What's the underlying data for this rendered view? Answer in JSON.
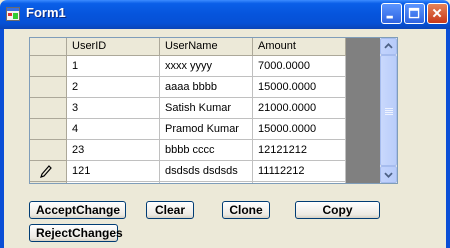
{
  "window": {
    "title": "Form1"
  },
  "grid": {
    "columns": [
      "UserID",
      "UserName",
      "Amount"
    ],
    "rows": [
      [
        "1",
        "xxxx yyyy",
        "7000.0000"
      ],
      [
        "2",
        "aaaa bbbb",
        "15000.0000"
      ],
      [
        "3",
        "Satish Kumar",
        "21000.0000"
      ],
      [
        "4",
        "Pramod Kumar",
        "15000.0000"
      ],
      [
        "23",
        "bbbb cccc",
        "12121212"
      ],
      [
        "121",
        "dsdsds dsdsds",
        "11112212"
      ]
    ],
    "editing_row": 5
  },
  "buttons": {
    "accept_changes": "AcceptChange",
    "clear": "Clear",
    "clone": "Clone",
    "copy": "Copy",
    "reject_changes": "RejectChanges"
  },
  "icons": {
    "app": "form-icon",
    "minimize": "minimize-icon",
    "maximize": "maximize-icon",
    "close": "close-icon",
    "row_edit": "pencil-icon"
  },
  "colors": {
    "titlebar": "#0654dc",
    "close_button": "#c8381a",
    "grid_background": "#808080"
  }
}
